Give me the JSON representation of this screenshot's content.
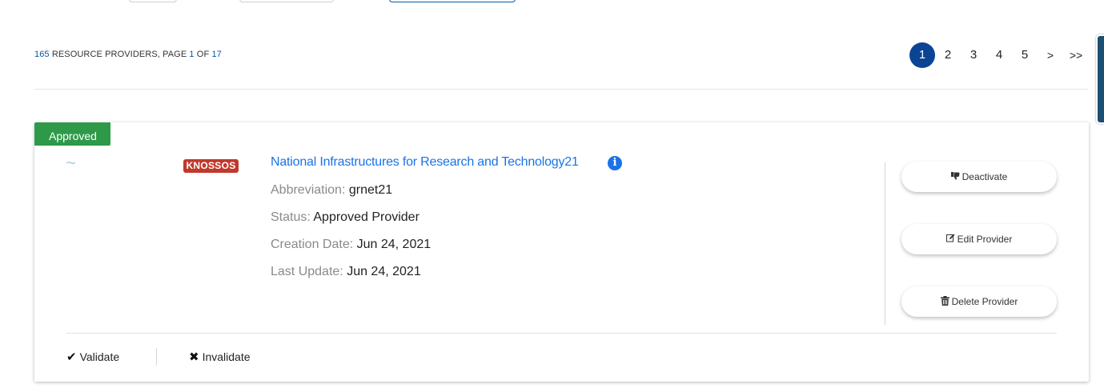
{
  "summary": {
    "count": "165",
    "label": "RESOURCE PROVIDERS, PAGE",
    "page": "1",
    "of": "OF",
    "total": "17"
  },
  "pagination": {
    "pages": [
      "1",
      "2",
      "3",
      "4",
      "5"
    ],
    "next": ">",
    "last": ">>",
    "active": "1"
  },
  "card": {
    "status_badge": "Approved",
    "logo_text": "KNOSSOS",
    "title": "National Infrastructures for Research and Technology21",
    "info_icon": "i",
    "fields": {
      "abbreviation_label": "Abbreviation:",
      "abbreviation_value": "grnet21",
      "status_label": "Status:",
      "status_value": "Approved Provider",
      "creation_label": "Creation Date:",
      "creation_value": "Jun 24, 2021",
      "update_label": "Last Update:",
      "update_value": "Jun 24, 2021"
    },
    "actions": {
      "deactivate": "Deactivate",
      "edit": "Edit Provider",
      "delete": "Delete Provider"
    },
    "footer": {
      "validate": "Validate",
      "invalidate": "Invalidate"
    }
  },
  "colors": {
    "accent": "#0a4595",
    "link": "#1a73e8",
    "approved": "#2e9a49",
    "logo": "#c0392b"
  },
  "icons": {
    "deactivate": "thumbs-down-icon",
    "edit": "edit-icon",
    "delete": "trash-icon",
    "validate": "check-icon",
    "invalidate": "x-icon",
    "info": "info-icon"
  }
}
